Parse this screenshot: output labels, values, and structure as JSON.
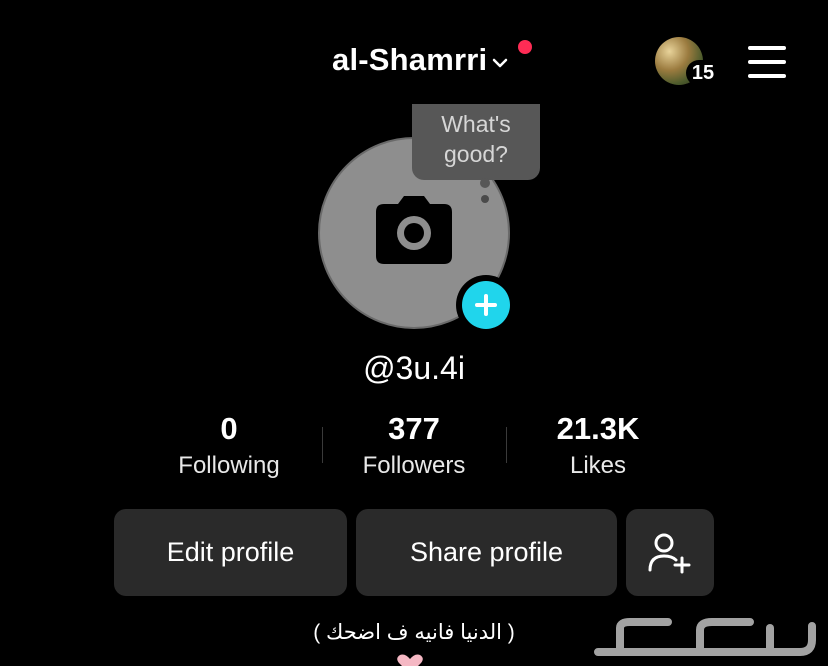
{
  "header": {
    "username": "al-Shamrri",
    "story_count": "15",
    "menu_icon": "hamburger-menu-icon"
  },
  "colors": {
    "background": "#000000",
    "notification": "#fe2c55",
    "add_button": "#20d5ec",
    "button_bg": "#2a2a2a"
  },
  "avatar": {
    "bubble_text_line1": "What's",
    "bubble_text_line2": "good?",
    "placeholder_icon": "camera-icon",
    "add_icon": "plus-icon"
  },
  "profile": {
    "handle": "@3u.4i",
    "bio": "( الدنيا فانيه ف اضحك )"
  },
  "stats": [
    {
      "value": "0",
      "label": "Following"
    },
    {
      "value": "377",
      "label": "Followers"
    },
    {
      "value": "21.3K",
      "label": "Likes"
    }
  ],
  "actions": {
    "edit_profile": "Edit profile",
    "share_profile": "Share profile",
    "add_friends_icon": "add-friend-icon"
  }
}
